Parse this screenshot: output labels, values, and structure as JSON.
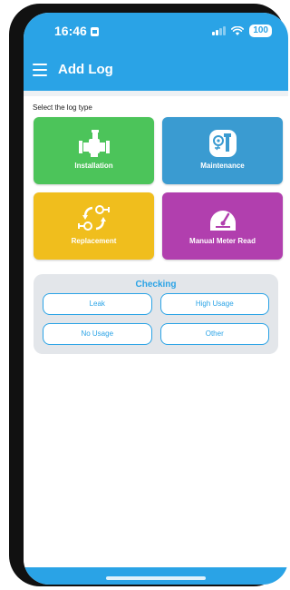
{
  "status_bar": {
    "time": "16:46",
    "battery": "100"
  },
  "app_bar": {
    "title": "Add Log",
    "menu_icon": "hamburger-icon"
  },
  "section_label": "Select the log type",
  "log_types": [
    {
      "label": "Installation",
      "color": "#4cc45a",
      "icon": "pipe-fitting-icon"
    },
    {
      "label": "Maintenance",
      "color": "#3a9bd1",
      "icon": "maintenance-tools-icon"
    },
    {
      "label": "Replacement",
      "color": "#f0be1d",
      "icon": "replacement-cycle-icon"
    },
    {
      "label": "Manual Meter Read",
      "color": "#b13fae",
      "icon": "gauge-icon"
    }
  ],
  "checking": {
    "title": "Checking",
    "options": [
      "Leak",
      "High Usage",
      "No Usage",
      "Other"
    ]
  },
  "colors": {
    "accent": "#2aa3e6",
    "panel": "#e3e6ea"
  }
}
